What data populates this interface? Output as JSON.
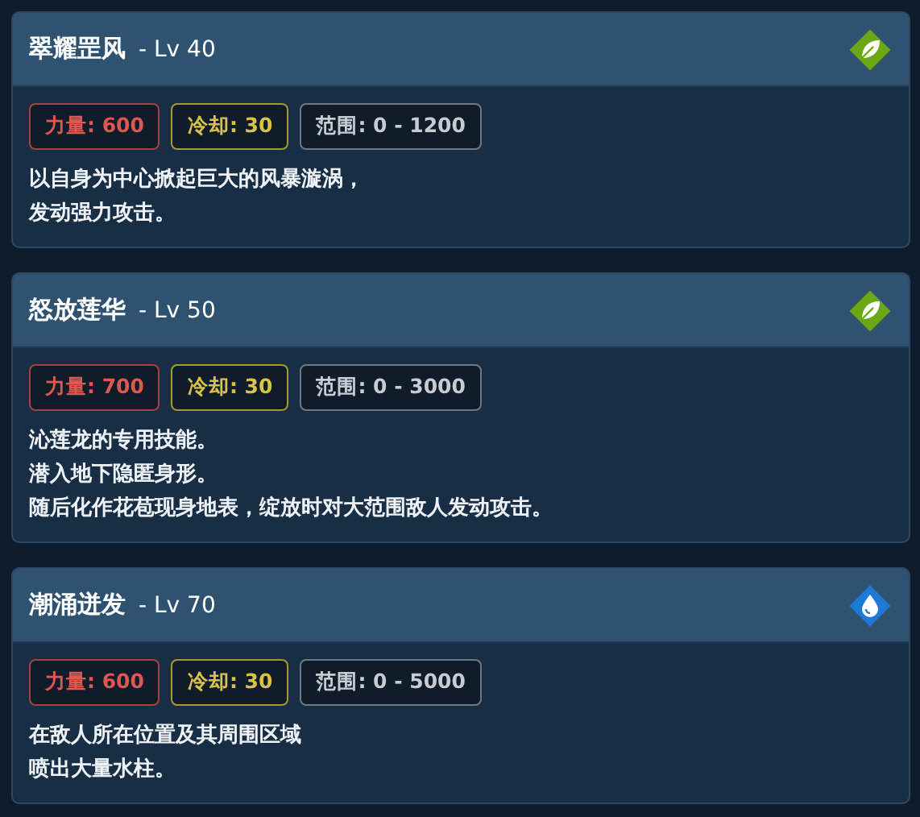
{
  "skills": [
    {
      "name": "翠耀罡风",
      "level": "- Lv 40",
      "kind": "leaf",
      "stats": [
        {
          "kind": "power",
          "text": "力量: 600"
        },
        {
          "kind": "cooldown",
          "text": "冷却: 30"
        },
        {
          "kind": "range",
          "text": "范围: 0 - 1200"
        }
      ],
      "description": [
        "以自身为中心掀起巨大的风暴漩涡，",
        "发动强力攻击。"
      ]
    },
    {
      "name": "怒放莲华",
      "level": "- Lv 50",
      "kind": "leaf",
      "stats": [
        {
          "kind": "power",
          "text": "力量: 700"
        },
        {
          "kind": "cooldown",
          "text": "冷却: 30"
        },
        {
          "kind": "range",
          "text": "范围: 0 - 3000"
        }
      ],
      "description": [
        "沁莲龙的专用技能。",
        "潜入地下隐匿身形。",
        "随后化作花苞现身地表，绽放时对大范围敌人发动攻击。"
      ]
    },
    {
      "name": "潮涌迸发",
      "level": "- Lv 70",
      "kind": "water",
      "stats": [
        {
          "kind": "power",
          "text": "力量: 600"
        },
        {
          "kind": "cooldown",
          "text": "冷却: 30"
        },
        {
          "kind": "range",
          "text": "范围: 0 - 5000"
        }
      ],
      "description": [
        "在敌人所在位置及其周围区域",
        "喷出大量水柱。"
      ]
    }
  ]
}
